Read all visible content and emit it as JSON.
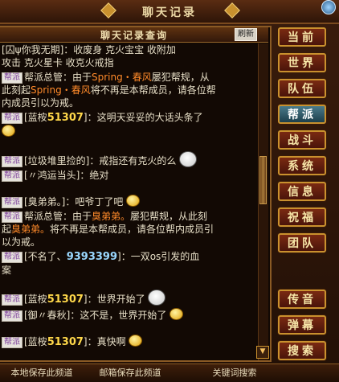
{
  "window": {
    "title": "聊天记录",
    "close_icon": "close-circle-icon"
  },
  "chat": {
    "header_title": "聊天记录查询",
    "refresh_label": "刷新",
    "messages": {
      "m1": {
        "line1": "[囚ψ你我无期]：收废身 克火宝宝 收附加",
        "line2": "攻击 克火星卡 收克火戒指"
      },
      "m2": {
        "tag": "帮派",
        "a": "帮派总管：由于",
        "b": "Spring・春风",
        "c": "屡犯帮规，从",
        "d": "此刻起",
        "e": "Spring・春风",
        "f": "将不再是本帮成员，请各位帮",
        "g": "内成员引以为戒。"
      },
      "m3": {
        "tag": "帮派",
        "a": "[蓝桉",
        "num": "51307",
        "b": "]：这明天妥妥的大话头条了"
      },
      "m4": {
        "tag": "帮派",
        "text": "[垃圾堆里捡的]：戒指还有克火的么"
      },
      "m5": {
        "tag": "帮派",
        "text": "[〃鸿运当头]：绝对"
      },
      "m6": {
        "tag": "帮派",
        "text": "[臭弟弟。]：吧爷丁了吧"
      },
      "m7": {
        "tag": "帮派",
        "a": "帮派总管：由于",
        "b": "臭弟弟。",
        "c": "屡犯帮规，从此刻",
        "d": "起",
        "e": "臭弟弟。",
        "f": "将不再是本帮成员，请各位帮内成员引",
        "g": "以为戒。"
      },
      "m8": {
        "tag": "帮派",
        "a": "[不名了、",
        "num": "9393399",
        "b": "]：一双os引发的血",
        "c": "案"
      },
      "m9": {
        "tag": "帮派",
        "a": "[蓝桉",
        "num": "51307",
        "b": "]：世界开始了"
      },
      "m10": {
        "tag": "帮派",
        "text": "[御〃春秋]：这不是，世界开始了"
      },
      "m11": {
        "tag": "帮派",
        "a": "[蓝桉",
        "num": "51307",
        "b": "]：真快啊"
      }
    }
  },
  "channels": {
    "current": "当前",
    "world": "世界",
    "team": "队伍",
    "gang": "帮派",
    "battle": "战斗",
    "system": "系统",
    "info": "信息",
    "blessing": "祝福",
    "group": "团队",
    "rumor": "传音",
    "barrage": "弹幕",
    "search": "搜索"
  },
  "bottom": {
    "local_save": "本地保存此频道",
    "mail_save": "邮箱保存此频道",
    "keyword_search": "关键词搜索"
  },
  "colors": {
    "accent": "#c9912e",
    "highlight_name": "#ff8a2a",
    "number_gold": "#ffd84a",
    "active_channel": "#1c3f4c"
  }
}
